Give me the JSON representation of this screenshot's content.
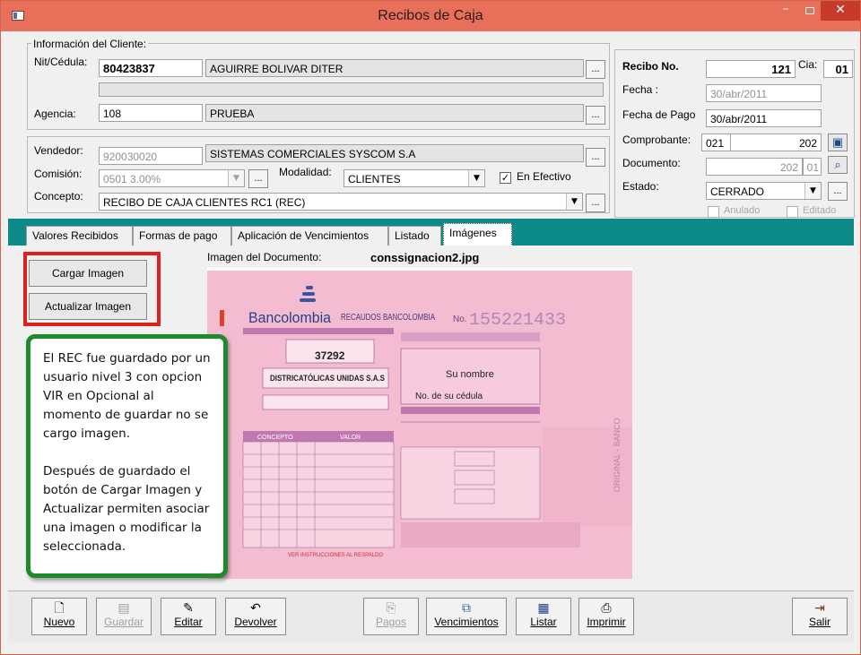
{
  "window": {
    "title": "Recibos de Caja"
  },
  "cliente": {
    "group_label": "Información del Cliente:",
    "nit_label": "Nit/Cédula:",
    "nit_value": "80423837",
    "nombre_value": "AGUIRRE BOLIVAR DITER",
    "agencia_label": "Agencia:",
    "agencia_code": "108",
    "agencia_name": "PRUEBA"
  },
  "recibo": {
    "recibo_label": "Recibo No.",
    "recibo_value": "121",
    "cia_label": "Cia:",
    "cia_value": "01",
    "fecha_label": "Fecha :",
    "fecha_value": "30/abr/2011",
    "fecha_pago_label": "Fecha de Pago",
    "fecha_pago_value": "30/abr/2011",
    "comprobante_label": "Comprobante:",
    "comprobante_code": "021",
    "comprobante_num": "202",
    "documento_label": "Documento:",
    "documento_num": "202",
    "documento_suffix": "01",
    "estado_label": "Estado:",
    "estado_value": "CERRADO",
    "anulado_label": "Anulado",
    "editado_label": "Editado"
  },
  "vendedor": {
    "vendedor_label": "Vendedor:",
    "vendedor_code": "920030020",
    "vendedor_name": "SISTEMAS COMERCIALES SYSCOM S.A",
    "comision_label": "Comisión:",
    "comision_value": "0501  3.00%",
    "modalidad_label": "Modalidad:",
    "modalidad_value": "CLIENTES",
    "en_efectivo_label": "En Efectivo",
    "concepto_label": "Concepto:",
    "concepto_value": "RECIBO DE CAJA CLIENTES RC1 (REC)"
  },
  "tabs": [
    {
      "label": "Valores Recibidos"
    },
    {
      "label": "Formas de pago"
    },
    {
      "label": "Aplicación de Vencimientos"
    },
    {
      "label": "Listado"
    },
    {
      "label": "Imágenes"
    }
  ],
  "imagenes": {
    "cargar_button": "Cargar Imagen",
    "actualizar_button": "Actualizar Imagen",
    "imagen_label": "Imagen del Documento:",
    "imagen_filename": "conssignacion2.jpg"
  },
  "slip": {
    "brand": "Bancolombia",
    "header": "RECAUDOS BANCOLOMBIA",
    "number_prefix": "No.",
    "number": "155221433",
    "codigo": "37292",
    "empresa": "DISTRICATÓLICAS UNIDAS S.A.S",
    "su_nombre": "Su nombre",
    "cedula": "No. de su cédula",
    "concepto": "CONCEPTO",
    "valor": "VALOR",
    "footer_note": "VER INSTRUCCIONES AL RESPALDO",
    "side_text": "ORIGINAL - BANCO"
  },
  "note": {
    "paragraph1": "El REC fue guardado por un usuario nivel 3 con opcion VIR en Opcional al momento de guardar no se cargo imagen.",
    "paragraph2": "Después de guardado el botón de Cargar Imagen y Actualizar permiten asociar una imagen o modificar la seleccionada."
  },
  "toolbar": {
    "nuevo": "Nuevo",
    "guardar": "Guardar",
    "editar": "Editar",
    "devolver": "Devolver",
    "pagos": "Pagos",
    "vencimientos": "Vencimientos",
    "listar": "Listar",
    "imprimir": "Imprimir",
    "salir": "Salir"
  },
  "colors": {
    "titlebar": "#e8705a",
    "tab_strip": "#0c8a8a",
    "highlight_red": "#e0201c",
    "note_border": "#1e8a2a",
    "slip_pink": "#f3bcd0"
  }
}
